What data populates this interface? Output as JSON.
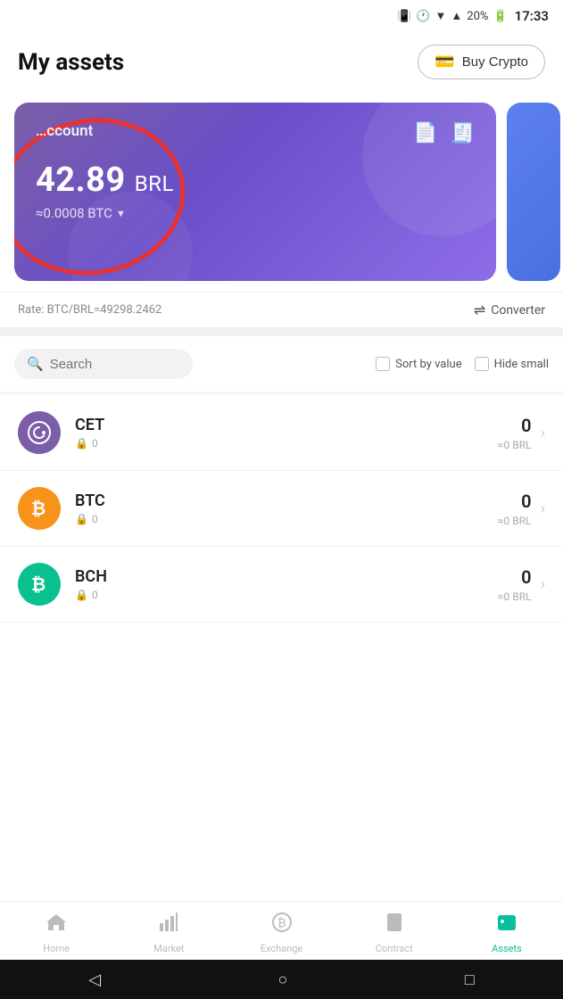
{
  "statusBar": {
    "battery": "20%",
    "time": "17:33"
  },
  "header": {
    "title": "My assets",
    "buyButton": "Buy Crypto"
  },
  "card": {
    "accountLabel": "…ccount",
    "amount": "42.89",
    "currency": "BRL",
    "btcEquiv": "≈0.0008 BTC"
  },
  "rateBar": {
    "rate": "Rate:  BTC/BRL=49298.2462",
    "converter": "Converter"
  },
  "search": {
    "placeholder": "Search",
    "sortByValue": "Sort by value",
    "hideSmall": "Hide small"
  },
  "assets": [
    {
      "symbol": "CET",
      "logoClass": "cet",
      "logoIcon": "©",
      "locked": "0",
      "value": "0",
      "brl": "≈0 BRL"
    },
    {
      "symbol": "BTC",
      "logoClass": "btc",
      "logoIcon": "₿",
      "locked": "0",
      "value": "0",
      "brl": "≈0 BRL"
    },
    {
      "symbol": "BCH",
      "logoClass": "bch",
      "logoIcon": "₿",
      "locked": "0",
      "value": "0",
      "brl": "≈0 BRL"
    }
  ],
  "bottomNav": [
    {
      "id": "home",
      "label": "Home",
      "icon": "⌂",
      "active": false
    },
    {
      "id": "market",
      "label": "Market",
      "icon": "📊",
      "active": false
    },
    {
      "id": "exchange",
      "label": "Exchange",
      "icon": "₿",
      "active": false
    },
    {
      "id": "contract",
      "label": "Contract",
      "icon": "📋",
      "active": false
    },
    {
      "id": "assets",
      "label": "Assets",
      "icon": "👛",
      "active": true
    }
  ],
  "android": {
    "back": "◁",
    "home": "○",
    "recents": "□"
  }
}
